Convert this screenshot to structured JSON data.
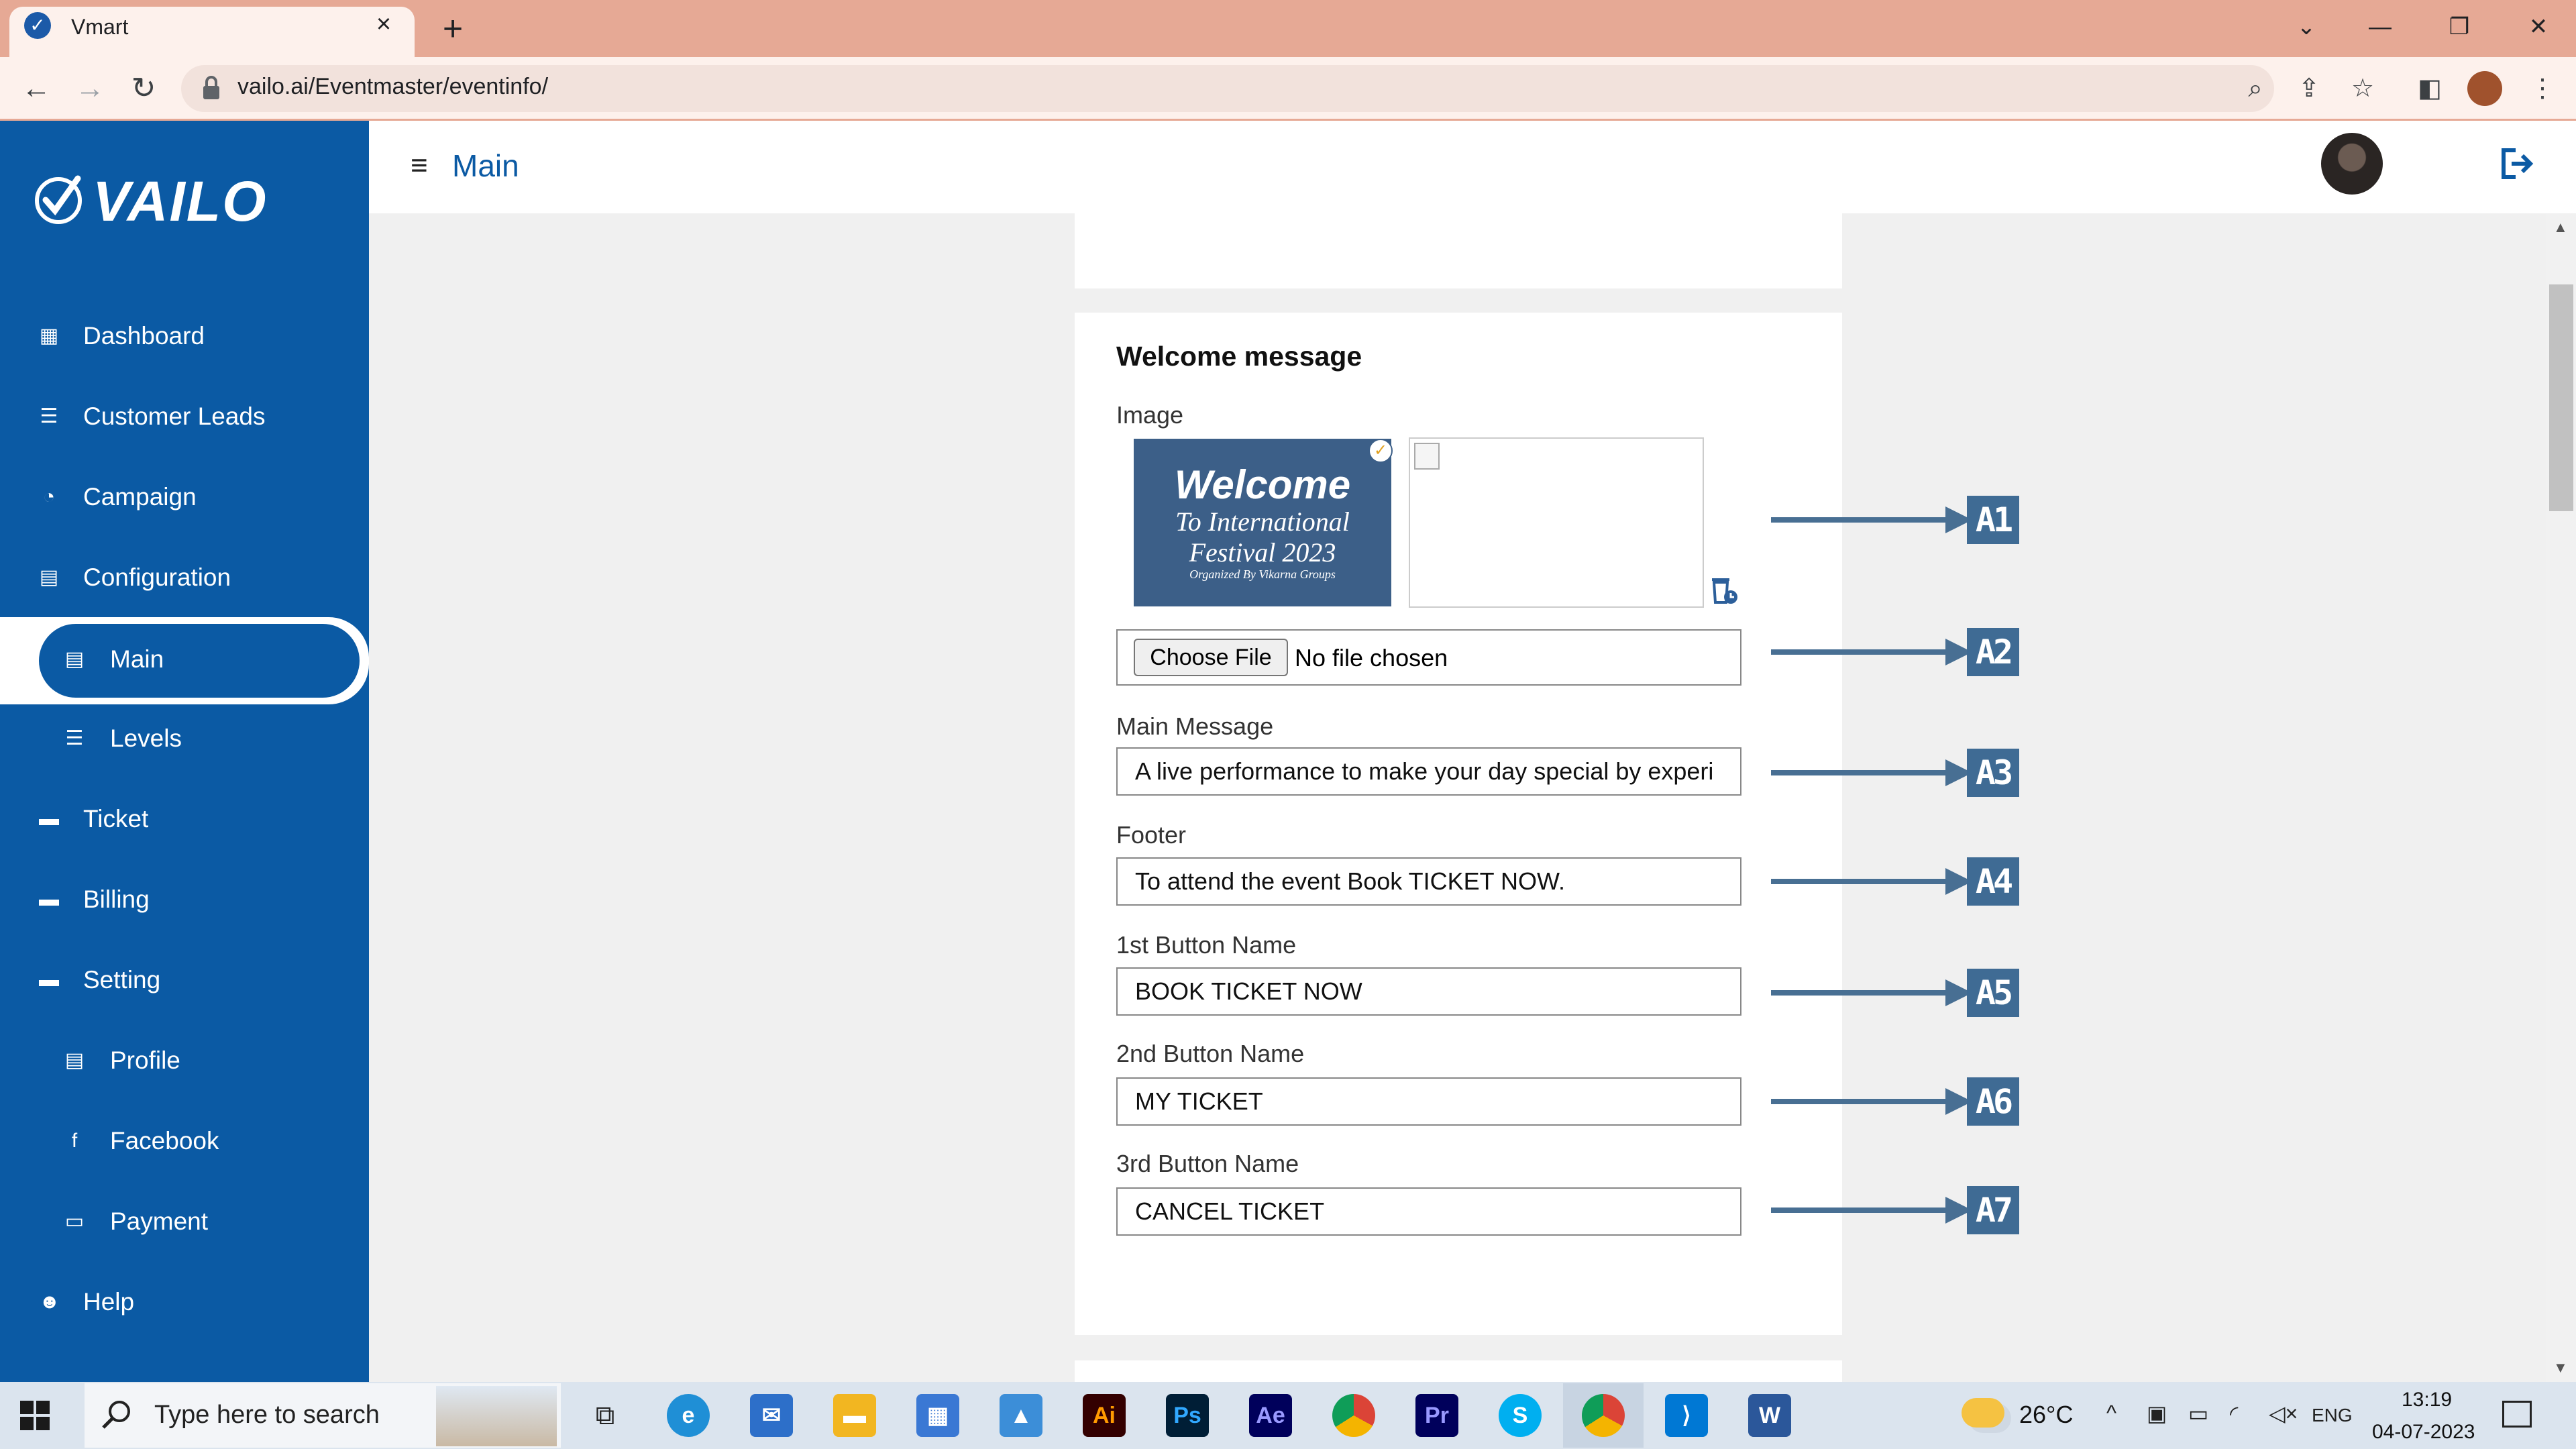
{
  "browser": {
    "tab_title": "Vmart",
    "url": "vailo.ai/Eventmaster/eventinfo/"
  },
  "sidebar": {
    "logo_text": "VAILO",
    "items": [
      {
        "label": "Dashboard",
        "icon": "dashboard-icon"
      },
      {
        "label": "Customer Leads",
        "icon": "contacts-icon"
      },
      {
        "label": "Campaign",
        "icon": "gauge-icon"
      },
      {
        "label": "Configuration",
        "icon": "document-icon"
      },
      {
        "label": "Main",
        "icon": "document-icon",
        "active": true
      },
      {
        "label": "Levels",
        "icon": "list-icon"
      },
      {
        "label": "Ticket",
        "icon": "chat-icon"
      },
      {
        "label": "Billing",
        "icon": "chat-icon"
      },
      {
        "label": "Setting",
        "icon": "chat-icon"
      },
      {
        "label": "Profile",
        "icon": "document-icon"
      },
      {
        "label": "Facebook",
        "icon": "facebook-icon"
      },
      {
        "label": "Payment",
        "icon": "wallet-icon"
      },
      {
        "label": "Help",
        "icon": "person-icon"
      }
    ]
  },
  "header": {
    "title": "Main"
  },
  "form": {
    "section_title": "Welcome message",
    "image_label": "Image",
    "image_preview": {
      "line1": "Welcome",
      "line2": "To International",
      "line3": "Festival 2023",
      "line4": "Organized By Vikarna Groups"
    },
    "choose_file": "Choose File",
    "no_file": "No file chosen",
    "main_message_label": "Main Message",
    "main_message_value": "A live performance to make your day special by experi",
    "footer_label": "Footer",
    "footer_value": "To attend the event Book TICKET NOW.",
    "button1_label": "1st Button Name",
    "button1_value": "BOOK TICKET NOW",
    "button2_label": "2nd Button Name",
    "button2_value": "MY TICKET",
    "button3_label": "3rd Button Name",
    "button3_value": "CANCEL TICKET"
  },
  "annotations": [
    "A1",
    "A2",
    "A3",
    "A4",
    "A5",
    "A6",
    "A7"
  ],
  "colors": {
    "sidebar": "#0b5aa4",
    "accent": "#0b5aa4",
    "annotation": "#3f6b94",
    "chrome_tab": "#e6a995"
  },
  "taskbar": {
    "search_placeholder": "Type here to search",
    "weather": "26°C",
    "language": "ENG",
    "time": "13:19",
    "date": "04-07-2023",
    "apps": [
      "Ai",
      "Ps",
      "Ae",
      "Pr",
      "S"
    ]
  }
}
